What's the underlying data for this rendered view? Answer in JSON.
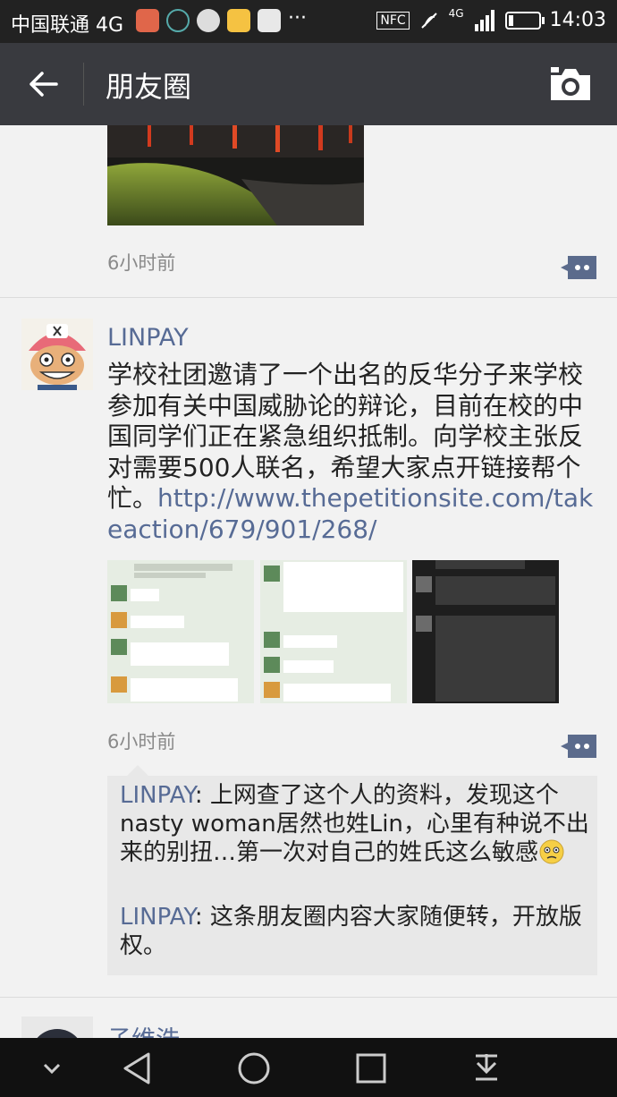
{
  "status_bar": {
    "carrier": "中国联通 4G",
    "nfc": "NFC",
    "network": "4G",
    "battery_level": 0.15,
    "time": "14:03"
  },
  "titlebar": {
    "title": "朋友圈"
  },
  "icons": {
    "back": "arrow-left-icon",
    "camera": "camera-icon",
    "comment": "comment-dots-icon",
    "nav_down": "chevron-down-icon",
    "nav_back": "triangle-back-icon",
    "nav_home": "circle-home-icon",
    "nav_recent": "square-recent-icon",
    "nav_notify": "notification-down-icon"
  },
  "previous_post": {
    "time": "6小时前"
  },
  "post": {
    "user": "LINPAY",
    "text": "学校社团邀请了一个出名的反华分子来学校参加有关中国威胁论的辩论，目前在校的中国同学们正在紧急组织抵制。向学校主张反对需要500人联名，希望大家点开链接帮个忙。",
    "link": "http://www.thepetitionsite.com/takeaction/679/901/268/",
    "time": "6小时前",
    "image_count": 3
  },
  "replies": [
    {
      "name": "LINPAY",
      "sep": ": ",
      "text": "上网查了这个人的资料，发现这个nasty woman居然也姓Lin，心里有种说不出来的别扭…第一次对自己的姓氏这么敏感",
      "emoji": "slight-frown-emoji"
    },
    {
      "name": "LINPAY",
      "sep": ": ",
      "text": "这条朋友圈内容大家随便转，开放版权。"
    }
  ],
  "next_post": {
    "user": "子维浩"
  }
}
